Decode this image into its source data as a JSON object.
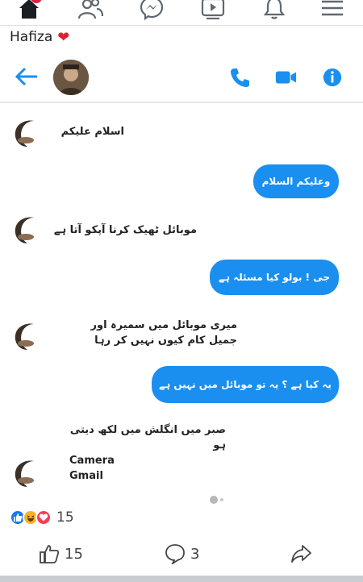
{
  "nav": {
    "items": [
      "home",
      "friends",
      "messenger",
      "watch",
      "notifications",
      "menu"
    ]
  },
  "post": {
    "author": "Hafiza",
    "author_emoji": "❤"
  },
  "chat": {
    "messages": [
      {
        "from": "them",
        "text": "اسلام علیکم"
      },
      {
        "from": "me",
        "text": "وعلیکم السلام"
      },
      {
        "from": "them",
        "text": "موبائل ٹھیک کرنا آپکو آتا ہے"
      },
      {
        "from": "me",
        "text": "جی ! بولو کیا مسئلہ ہے"
      },
      {
        "from": "them",
        "text": "میری موبائل میں سمیرہ اور جمیل کام کیوں نہیں کر رہا"
      },
      {
        "from": "me",
        "text": "یہ کیا ہے ؟ یہ تو موبائل میں نہیں ہے"
      },
      {
        "from": "them",
        "text": "صبر میں انگلش میں لکھ دیتی ہو"
      },
      {
        "from": "them",
        "text": "Camera"
      },
      {
        "from": "them",
        "text": "Gmail"
      }
    ]
  },
  "reactions": {
    "count": "15",
    "types": [
      "like",
      "haha",
      "love"
    ]
  },
  "actions": {
    "likes": "15",
    "comments": "3"
  },
  "colors": {
    "facebook_blue": "#1877f2",
    "bubble_blue": "#1a8ff0",
    "messenger_icon": "#1a8ff0",
    "love_red": "#f33e58",
    "haha_yellow": "#f7b125"
  }
}
